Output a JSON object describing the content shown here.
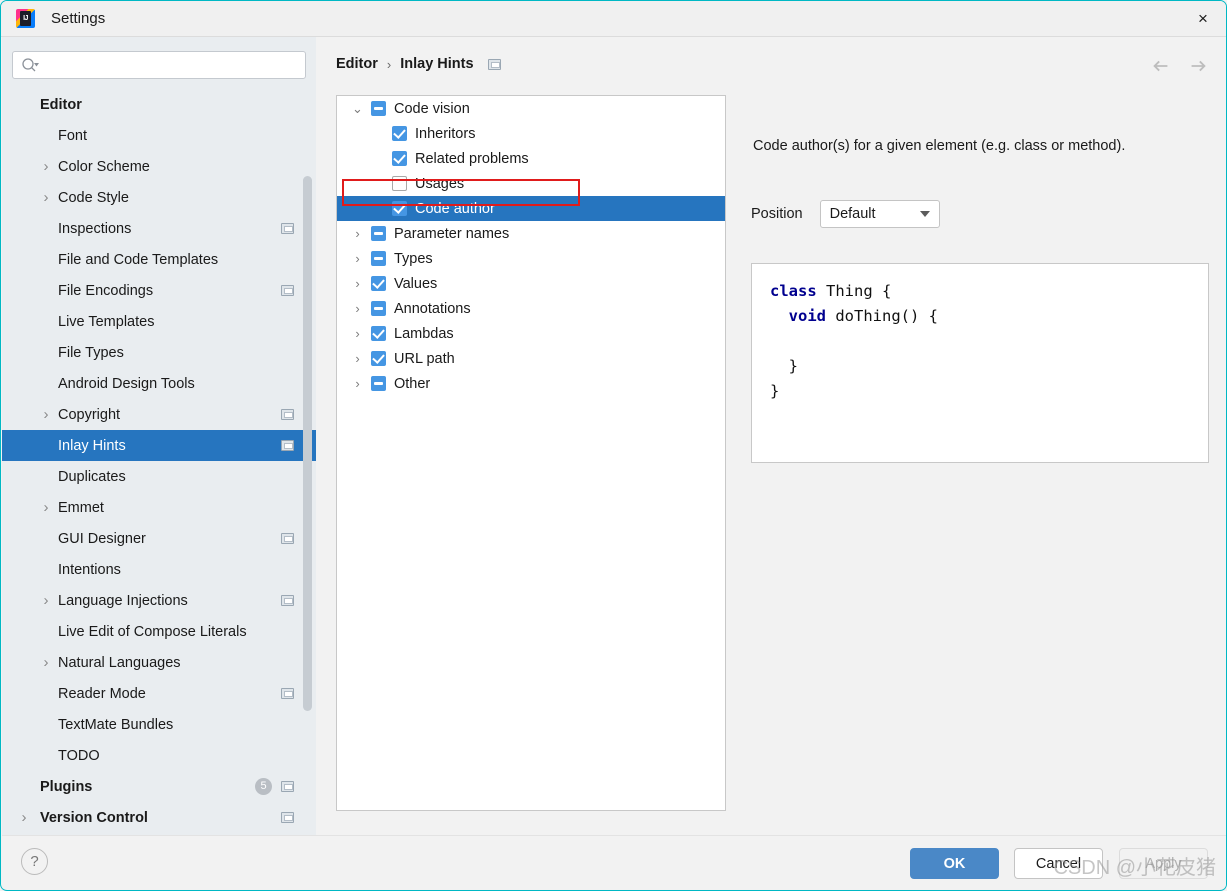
{
  "window": {
    "title": "Settings",
    "logo_text": "IJ",
    "close_icon": "×",
    "accent_color": "#00b8c4"
  },
  "sidebar": {
    "search": {
      "value": "",
      "placeholder": ""
    },
    "items": [
      {
        "label": "Editor",
        "group": true,
        "twisty": "",
        "selected": false,
        "badge": false,
        "count": ""
      },
      {
        "label": "Font",
        "group": false,
        "twisty": "",
        "selected": false,
        "badge": false,
        "count": ""
      },
      {
        "label": "Color Scheme",
        "group": false,
        "twisty": "›",
        "selected": false,
        "badge": false,
        "count": ""
      },
      {
        "label": "Code Style",
        "group": false,
        "twisty": "›",
        "selected": false,
        "badge": false,
        "count": ""
      },
      {
        "label": "Inspections",
        "group": false,
        "twisty": "",
        "selected": false,
        "badge": true,
        "count": ""
      },
      {
        "label": "File and Code Templates",
        "group": false,
        "twisty": "",
        "selected": false,
        "badge": false,
        "count": ""
      },
      {
        "label": "File Encodings",
        "group": false,
        "twisty": "",
        "selected": false,
        "badge": true,
        "count": ""
      },
      {
        "label": "Live Templates",
        "group": false,
        "twisty": "",
        "selected": false,
        "badge": false,
        "count": ""
      },
      {
        "label": "File Types",
        "group": false,
        "twisty": "",
        "selected": false,
        "badge": false,
        "count": ""
      },
      {
        "label": "Android Design Tools",
        "group": false,
        "twisty": "",
        "selected": false,
        "badge": false,
        "count": ""
      },
      {
        "label": "Copyright",
        "group": false,
        "twisty": "›",
        "selected": false,
        "badge": true,
        "count": ""
      },
      {
        "label": "Inlay Hints",
        "group": false,
        "twisty": "",
        "selected": true,
        "badge": true,
        "count": ""
      },
      {
        "label": "Duplicates",
        "group": false,
        "twisty": "",
        "selected": false,
        "badge": false,
        "count": ""
      },
      {
        "label": "Emmet",
        "group": false,
        "twisty": "›",
        "selected": false,
        "badge": false,
        "count": ""
      },
      {
        "label": "GUI Designer",
        "group": false,
        "twisty": "",
        "selected": false,
        "badge": true,
        "count": ""
      },
      {
        "label": "Intentions",
        "group": false,
        "twisty": "",
        "selected": false,
        "badge": false,
        "count": ""
      },
      {
        "label": "Language Injections",
        "group": false,
        "twisty": "›",
        "selected": false,
        "badge": true,
        "count": ""
      },
      {
        "label": "Live Edit of Compose Literals",
        "group": false,
        "twisty": "",
        "selected": false,
        "badge": false,
        "count": ""
      },
      {
        "label": "Natural Languages",
        "group": false,
        "twisty": "›",
        "selected": false,
        "badge": false,
        "count": ""
      },
      {
        "label": "Reader Mode",
        "group": false,
        "twisty": "",
        "selected": false,
        "badge": true,
        "count": ""
      },
      {
        "label": "TextMate Bundles",
        "group": false,
        "twisty": "",
        "selected": false,
        "badge": false,
        "count": ""
      },
      {
        "label": "TODO",
        "group": false,
        "twisty": "",
        "selected": false,
        "badge": false,
        "count": ""
      },
      {
        "label": "Plugins",
        "group": true,
        "twisty": "",
        "selected": false,
        "badge": true,
        "count": "5"
      },
      {
        "label": "Version Control",
        "group": true,
        "twisty": "›",
        "selected": false,
        "badge": true,
        "count": ""
      }
    ]
  },
  "main": {
    "breadcrumb": {
      "parent": "Editor",
      "separator": "›",
      "current": "Inlay Hints"
    },
    "nav": {
      "back_icon": "←",
      "forward_icon": "→"
    },
    "hint_tree": [
      {
        "label": "Code vision",
        "indent": 0,
        "arrow": "⌄",
        "state": "indeterminate",
        "selected": false,
        "highlight": false
      },
      {
        "label": "Inheritors",
        "indent": 1,
        "arrow": "",
        "state": "checked",
        "selected": false,
        "highlight": false
      },
      {
        "label": "Related problems",
        "indent": 1,
        "arrow": "",
        "state": "checked",
        "selected": false,
        "highlight": false
      },
      {
        "label": "Usages",
        "indent": 1,
        "arrow": "",
        "state": "unchecked",
        "selected": false,
        "highlight": true
      },
      {
        "label": "Code author",
        "indent": 1,
        "arrow": "",
        "state": "checked",
        "selected": true,
        "highlight": false
      },
      {
        "label": "Parameter names",
        "indent": 0,
        "arrow": "›",
        "state": "indeterminate",
        "selected": false,
        "highlight": false
      },
      {
        "label": "Types",
        "indent": 0,
        "arrow": "›",
        "state": "indeterminate",
        "selected": false,
        "highlight": false
      },
      {
        "label": "Values",
        "indent": 0,
        "arrow": "›",
        "state": "checked",
        "selected": false,
        "highlight": false
      },
      {
        "label": "Annotations",
        "indent": 0,
        "arrow": "›",
        "state": "indeterminate",
        "selected": false,
        "highlight": false
      },
      {
        "label": "Lambdas",
        "indent": 0,
        "arrow": "›",
        "state": "checked",
        "selected": false,
        "highlight": false
      },
      {
        "label": "URL path",
        "indent": 0,
        "arrow": "›",
        "state": "checked",
        "selected": false,
        "highlight": false
      },
      {
        "label": "Other",
        "indent": 0,
        "arrow": "›",
        "state": "indeterminate",
        "selected": false,
        "highlight": false
      }
    ],
    "detail": {
      "description": "Code author(s) for a given element (e.g. class or method).",
      "position_label": "Position",
      "position_value": "Default",
      "code_lines": [
        {
          "keyword": "class",
          "rest": " Thing {",
          "indent": 0
        },
        {
          "keyword": "void",
          "rest": " doThing() {",
          "indent": 1
        },
        {
          "keyword": "",
          "rest": "",
          "indent": 0
        },
        {
          "keyword": "",
          "rest": "}",
          "indent": 1
        },
        {
          "keyword": "",
          "rest": "}",
          "indent": 0
        }
      ]
    }
  },
  "footer": {
    "help_icon": "?",
    "ok_label": "OK",
    "cancel_label": "Cancel",
    "apply_label": "Apply"
  },
  "watermark": "CSDN @小花皮猪"
}
